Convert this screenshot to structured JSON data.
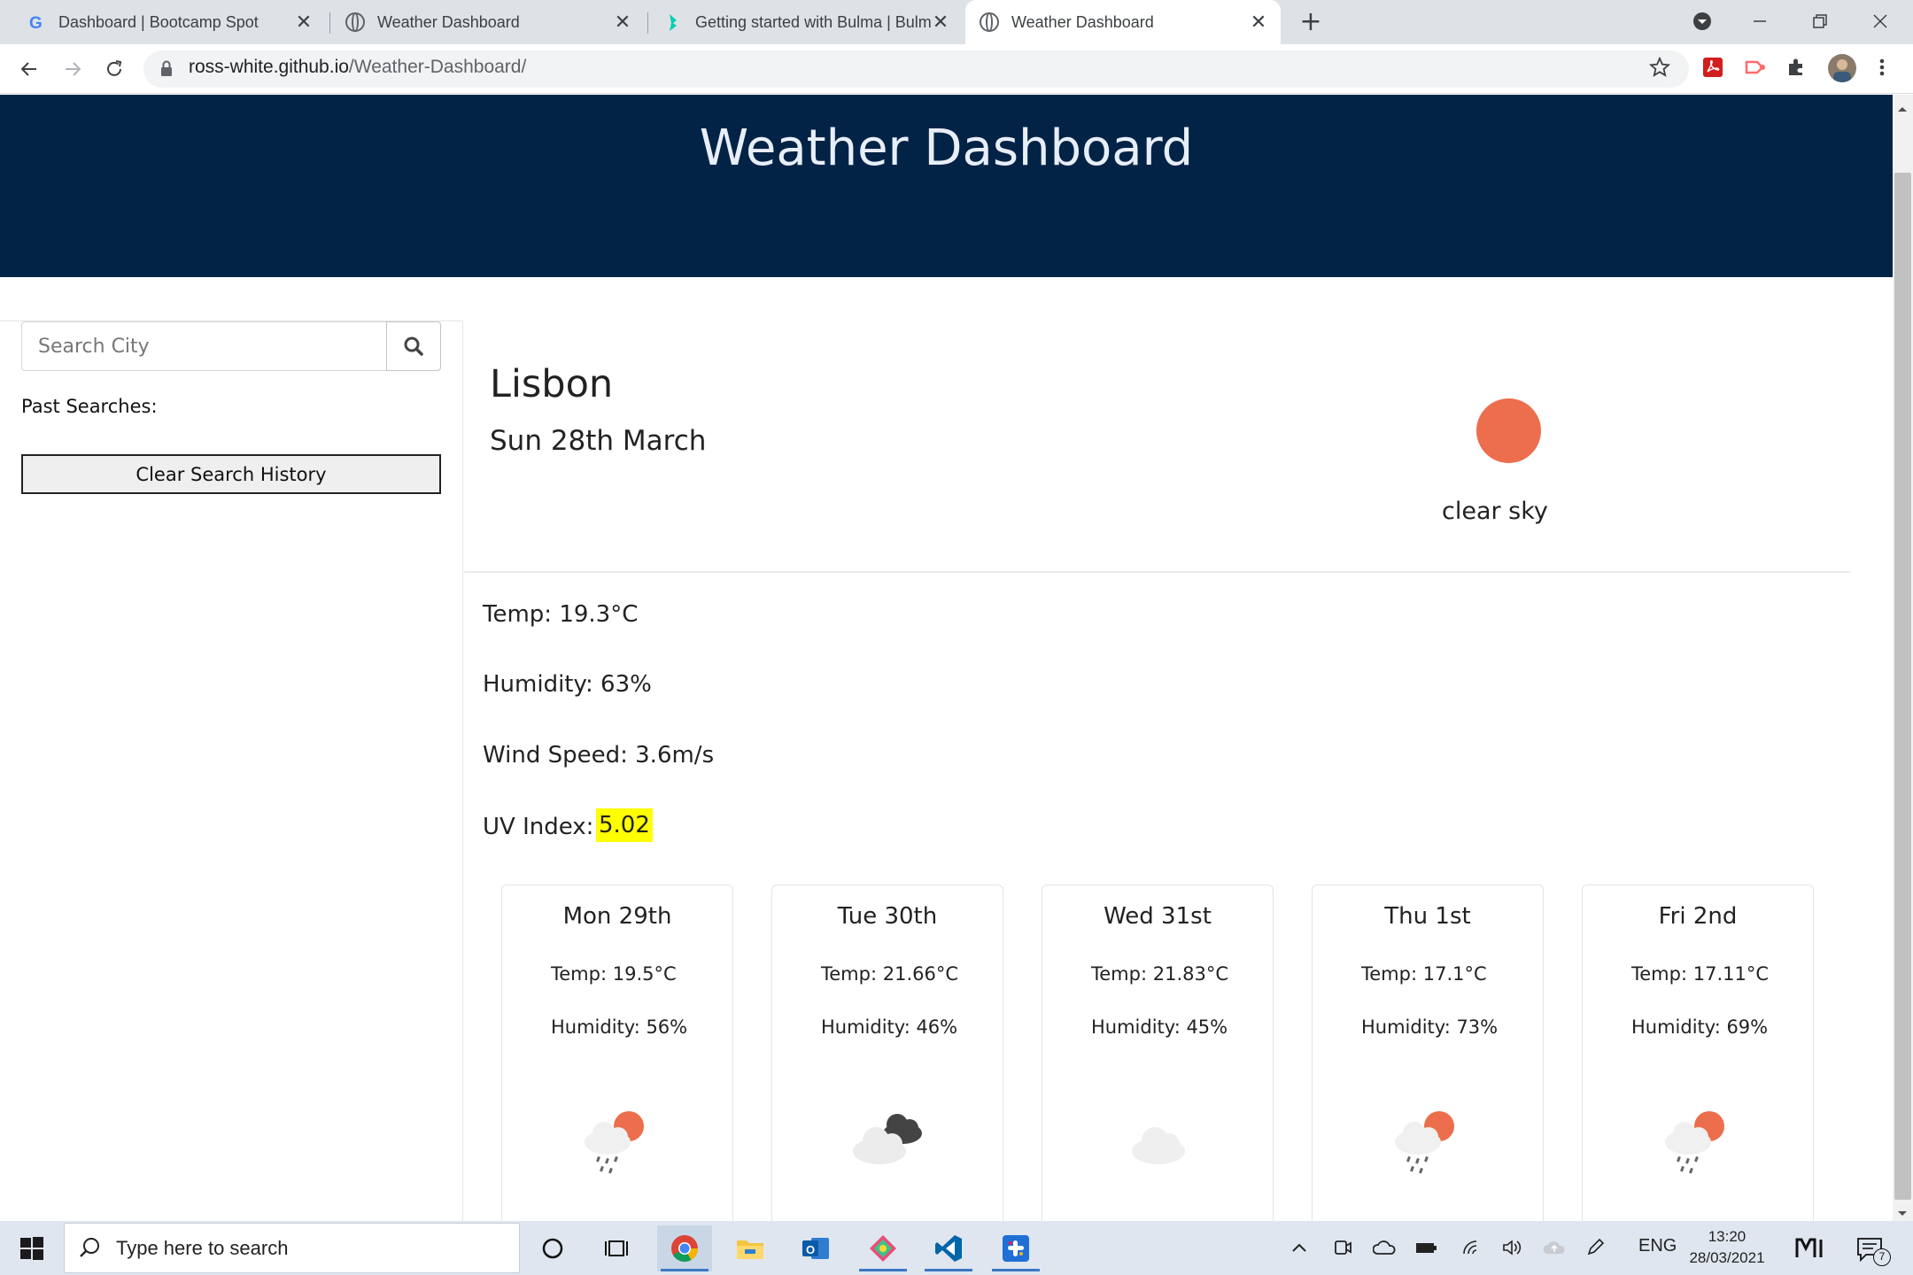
{
  "browser": {
    "tabs": [
      {
        "title": "Dashboard | Bootcamp Spot",
        "favicon": "google-icon",
        "active": false
      },
      {
        "title": "Weather Dashboard",
        "favicon": "globe-icon",
        "active": false
      },
      {
        "title": "Getting started with Bulma | Bulma",
        "favicon": "bulma-icon",
        "active": false
      },
      {
        "title": "Weather Dashboard",
        "favicon": "globe-icon",
        "active": true
      }
    ],
    "new_tab_symbol": "+",
    "url_host": "ross-white.github.io",
    "url_path": "/Weather-Dashboard/"
  },
  "page": {
    "header_title": "Weather Dashboard",
    "search": {
      "placeholder": "Search City",
      "value": ""
    },
    "past_searches_label": "Past Searches:",
    "clear_history_label": "Clear Search History",
    "current": {
      "city": "Lisbon",
      "date": "Sun 28th March",
      "condition": "clear sky",
      "icon": "clear-sky-icon",
      "temp": "Temp: 19.3°C",
      "humidity": "Humidity: 63%",
      "wind": "Wind Speed: 3.6m/s",
      "uv_label": "UV Index:",
      "uv_value": "5.02",
      "uv_color": "#ffff00"
    },
    "forecast": [
      {
        "day": "Mon 29th",
        "temp": "Temp: 19.5°C",
        "humidity": "Humidity: 56%",
        "icon": "sun-rain-icon"
      },
      {
        "day": "Tue 30th",
        "temp": "Temp: 21.66°C",
        "humidity": "Humidity: 46%",
        "icon": "broken-clouds-icon"
      },
      {
        "day": "Wed 31st",
        "temp": "Temp: 21.83°C",
        "humidity": "Humidity: 45%",
        "icon": "cloud-icon"
      },
      {
        "day": "Thu 1st",
        "temp": "Temp: 17.1°C",
        "humidity": "Humidity: 73%",
        "icon": "sun-rain-icon"
      },
      {
        "day": "Fri 2nd",
        "temp": "Temp: 17.11°C",
        "humidity": "Humidity: 69%",
        "icon": "sun-rain-icon"
      }
    ],
    "colors": {
      "header_bg": "#022345",
      "sun": "#ec6e4c",
      "uv_highlight": "#ffff00"
    }
  },
  "taskbar": {
    "search_placeholder": "Type here to search",
    "language": "ENG",
    "time": "13:20",
    "date": "28/03/2021",
    "notification_count": "7"
  }
}
